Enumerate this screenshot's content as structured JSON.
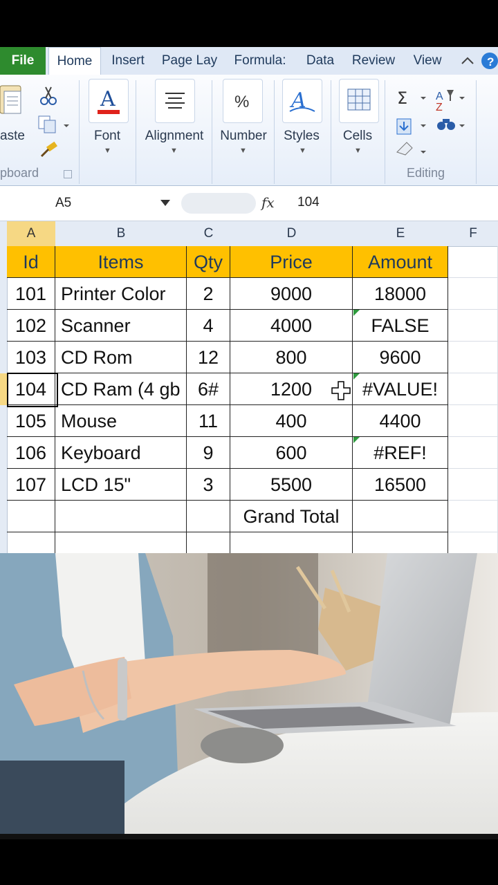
{
  "tabs": {
    "file": "File",
    "items": [
      "Home",
      "Insert",
      "Page Lay",
      "Formula:",
      "Data",
      "Review",
      "View"
    ]
  },
  "ribbon": {
    "clipboard_paste": "aste",
    "clipboard_label": "pboard",
    "font": "Font",
    "alignment": "Alignment",
    "number": "Number",
    "styles": "Styles",
    "cells": "Cells",
    "editing_label": "Editing"
  },
  "formula_bar": {
    "name_box": "A5",
    "fx": "fx",
    "value": "104"
  },
  "sheet": {
    "col_headers": [
      "A",
      "B",
      "C",
      "D",
      "E",
      "F"
    ],
    "header_row": [
      "Id",
      "Items",
      "Qty",
      "Price",
      "Amount"
    ],
    "rows": [
      [
        "101",
        "Printer Color",
        "2",
        "9000",
        "18000"
      ],
      [
        "102",
        "Scanner",
        "4",
        "4000",
        "FALSE"
      ],
      [
        "103",
        "CD Rom",
        "12",
        "800",
        "9600"
      ],
      [
        "104",
        "CD Ram (4 gb",
        "6#",
        "1200",
        "#VALUE!"
      ],
      [
        "105",
        "Mouse",
        "11",
        "400",
        "4400"
      ],
      [
        "106",
        "Keyboard",
        "9",
        "600",
        "#REF!"
      ],
      [
        "107",
        "LCD 15\"",
        "3",
        "5500",
        "16500"
      ]
    ],
    "grand_total": "Grand Total"
  },
  "colors": {
    "header_fill": "#ffc000",
    "file_tab": "#2e8b2e",
    "error_flag": "#2e9b3e"
  }
}
